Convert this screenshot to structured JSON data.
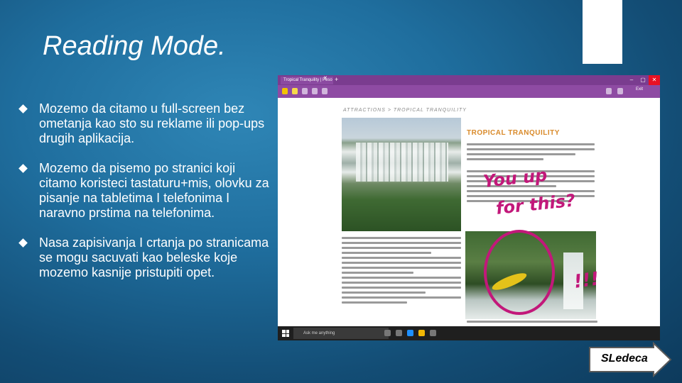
{
  "slide": {
    "title": "Reading Mode.",
    "bullets": [
      "Mozemo da citamo u full-screen bez ometanja kao sto su reklame ili pop-ups drugih aplikacija.",
      "Mozemo da pisemo po stranici koji citamo koristeci tastaturu+mis, olovku za pisanje na tabletima I telefonima I naravno prstima na telefonima.",
      "Nasa zapisivanja I crtanja po stranicama se mogu sacuvati kao beleske koje mozemo kasnije pristupiti opet."
    ],
    "next_button": "SLedeca"
  },
  "browser": {
    "tab_title": "Tropical Tranquility | Peso",
    "exit_label": "Exit",
    "breadcrumb": "ATTRACTIONS > TROPICAL TRANQUILITY",
    "article_heading": "TROPICAL TRANQUILITY",
    "search_placeholder": "Ask me anything",
    "ink_text": [
      "You up",
      "for this?",
      "!!!"
    ],
    "colors": {
      "accent": "#8e4ba3",
      "ink": "#c2187a",
      "heading": "#d98a2a"
    }
  }
}
